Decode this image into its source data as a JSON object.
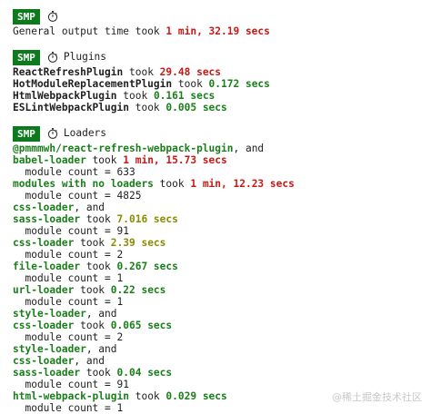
{
  "badge": "SMP",
  "general": {
    "label": "General output time took ",
    "time": "1 min, 32.19 secs",
    "time_color": "red"
  },
  "plugins": {
    "title": "Plugins",
    "items": [
      {
        "name": "ReactRefreshPlugin",
        "took": " took ",
        "time": "29.48 secs",
        "color": "red"
      },
      {
        "name": "HotModuleReplacementPlugin",
        "took": " took ",
        "time": "0.172 secs",
        "color": "green"
      },
      {
        "name": "HtmlWebpackPlugin",
        "took": " took ",
        "time": "0.161 secs",
        "color": "green"
      },
      {
        "name": "ESLintWebpackPlugin",
        "took": " took ",
        "time": "0.005 secs",
        "color": "green"
      }
    ]
  },
  "loaders": {
    "title": "Loaders",
    "lines": [
      {
        "parts": [
          {
            "t": "@pmmmwh/react-refresh-webpack-plugin",
            "c": "green"
          },
          {
            "t": ", and",
            "c": "plain"
          }
        ]
      },
      {
        "parts": [
          {
            "t": "babel-loader",
            "c": "green"
          },
          {
            "t": " took ",
            "c": "plain"
          },
          {
            "t": "1 min, 15.73 secs",
            "c": "red"
          }
        ]
      },
      {
        "parts": [
          {
            "t": "  module count = 633",
            "c": "plain"
          }
        ]
      },
      {
        "parts": [
          {
            "t": "modules with no loaders",
            "c": "green"
          },
          {
            "t": " took ",
            "c": "plain"
          },
          {
            "t": "1 min, 12.23 secs",
            "c": "red"
          }
        ]
      },
      {
        "parts": [
          {
            "t": "  module count = 4825",
            "c": "plain"
          }
        ]
      },
      {
        "parts": [
          {
            "t": "css-loader",
            "c": "green"
          },
          {
            "t": ", and",
            "c": "plain"
          }
        ]
      },
      {
        "parts": [
          {
            "t": "sass-loader",
            "c": "green"
          },
          {
            "t": " took ",
            "c": "plain"
          },
          {
            "t": "7.016 secs",
            "c": "olive"
          }
        ]
      },
      {
        "parts": [
          {
            "t": "  module count = 91",
            "c": "plain"
          }
        ]
      },
      {
        "parts": [
          {
            "t": "css-loader",
            "c": "green"
          },
          {
            "t": " took ",
            "c": "plain"
          },
          {
            "t": "2.39 secs",
            "c": "olive"
          }
        ]
      },
      {
        "parts": [
          {
            "t": "  module count = 2",
            "c": "plain"
          }
        ]
      },
      {
        "parts": [
          {
            "t": "file-loader",
            "c": "green"
          },
          {
            "t": " took ",
            "c": "plain"
          },
          {
            "t": "0.267 secs",
            "c": "green"
          }
        ]
      },
      {
        "parts": [
          {
            "t": "  module count = 1",
            "c": "plain"
          }
        ]
      },
      {
        "parts": [
          {
            "t": "url-loader",
            "c": "green"
          },
          {
            "t": " took ",
            "c": "plain"
          },
          {
            "t": "0.22 secs",
            "c": "green"
          }
        ]
      },
      {
        "parts": [
          {
            "t": "  module count = 1",
            "c": "plain"
          }
        ]
      },
      {
        "parts": [
          {
            "t": "style-loader",
            "c": "green"
          },
          {
            "t": ", and",
            "c": "plain"
          }
        ]
      },
      {
        "parts": [
          {
            "t": "css-loader",
            "c": "green"
          },
          {
            "t": " took ",
            "c": "plain"
          },
          {
            "t": "0.065 secs",
            "c": "green"
          }
        ]
      },
      {
        "parts": [
          {
            "t": "  module count = 2",
            "c": "plain"
          }
        ]
      },
      {
        "parts": [
          {
            "t": "style-loader",
            "c": "green"
          },
          {
            "t": ", and",
            "c": "plain"
          }
        ]
      },
      {
        "parts": [
          {
            "t": "css-loader",
            "c": "green"
          },
          {
            "t": ", and",
            "c": "plain"
          }
        ]
      },
      {
        "parts": [
          {
            "t": "sass-loader",
            "c": "green"
          },
          {
            "t": " took ",
            "c": "plain"
          },
          {
            "t": "0.04 secs",
            "c": "green"
          }
        ]
      },
      {
        "parts": [
          {
            "t": "  module count = 91",
            "c": "plain"
          }
        ]
      },
      {
        "parts": [
          {
            "t": "html-webpack-plugin",
            "c": "green"
          },
          {
            "t": " took ",
            "c": "plain"
          },
          {
            "t": "0.029 secs",
            "c": "green"
          }
        ]
      },
      {
        "parts": [
          {
            "t": "  module count = 1",
            "c": "plain"
          }
        ]
      }
    ]
  },
  "watermark": "@稀土掘金技术社区",
  "colors": {
    "badge_bg": "#0d7a1e",
    "green": "#1a7f1a",
    "red": "#c41a16",
    "olive": "#8c8c00"
  },
  "icons": {
    "timer": "stopwatch-icon"
  }
}
